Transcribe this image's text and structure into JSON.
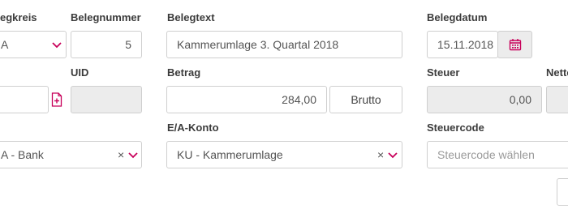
{
  "labels": {
    "belegkreis": "egkreis",
    "belegnummer": "Belegnummer",
    "belegtext": "Belegtext",
    "belegdatum": "Belegdatum",
    "uid": "UID",
    "betrag": "Betrag",
    "steuer": "Steuer",
    "netto": "Netto",
    "ea_konto": "E/A-Konto",
    "steuercode": "Steuercode"
  },
  "fields": {
    "belegkreis_value": "A",
    "belegnummer_value": "5",
    "belegtext_value": "Kammerumlage 3. Quartal 2018",
    "belegdatum_value": "15.11.2018",
    "uid_value": "",
    "betrag_value": "284,00",
    "brutto_button": "Brutto",
    "steuer_value": "0,00",
    "konto_value": "A - Bank",
    "ea_konto_value": "KU - Kammerumlage",
    "steuercode_placeholder": "Steuercode wählen",
    "clear_glyph": "×"
  },
  "colors": {
    "accent": "#c8005a",
    "border": "#cfcfcf",
    "readonly_bg": "#ececec",
    "label": "#3b3b3b"
  },
  "icons": [
    "chevron-down-icon",
    "calendar-icon",
    "add-document-icon",
    "clear-icon"
  ]
}
